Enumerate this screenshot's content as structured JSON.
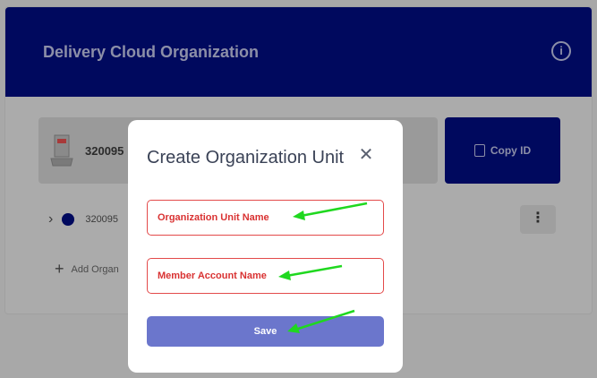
{
  "header": {
    "title": "Delivery Cloud Organization",
    "info_icon": "info-icon"
  },
  "org_selector": {
    "selected_id": "320095",
    "icon": "building-icon"
  },
  "copy_button": {
    "label": "Copy ID",
    "icon": "copy-icon"
  },
  "tree": {
    "item_id": "320095",
    "add_label": "Add Organ"
  },
  "modal": {
    "title": "Create Organization Unit",
    "fields": [
      {
        "placeholder": "Organization Unit Name"
      },
      {
        "placeholder": "Member Account Name"
      }
    ],
    "save_label": "Save"
  },
  "colors": {
    "brand": "#00095e",
    "error": "#e34a4a",
    "save": "#6b76cc",
    "annotation_arrow": "#1fd81f"
  }
}
